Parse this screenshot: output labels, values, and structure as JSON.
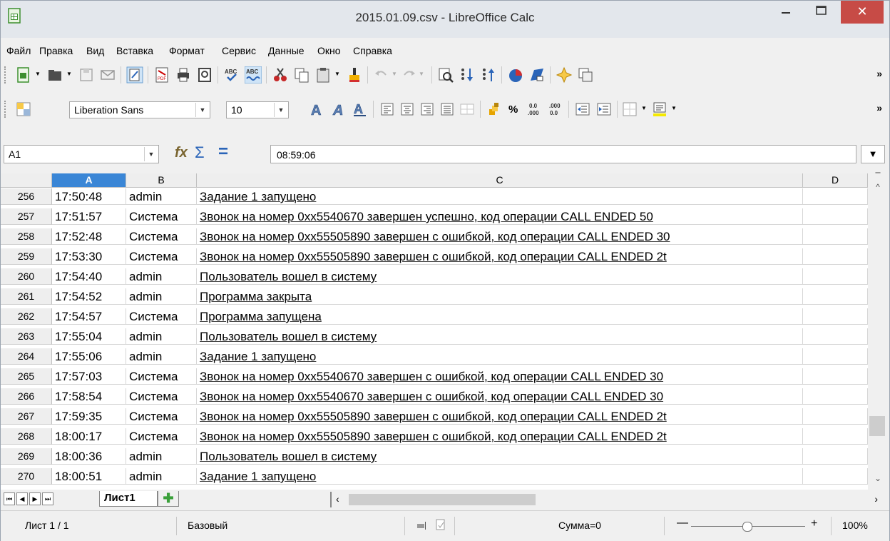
{
  "window": {
    "title": "2015.01.09.csv - LibreOffice Calc",
    "minimize": "–",
    "maximize": "☐",
    "close": "✕"
  },
  "menu": [
    {
      "label": "Файл"
    },
    {
      "label": "Правка"
    },
    {
      "label": "Вид"
    },
    {
      "label": "Вставка"
    },
    {
      "label": "Формат"
    },
    {
      "label": "Сервис"
    },
    {
      "label": "Данные"
    },
    {
      "label": "Окно"
    },
    {
      "label": "Справка"
    }
  ],
  "format_toolbar": {
    "font_name": "Liberation Sans",
    "font_size": "10",
    "percent": "%",
    "more": "»"
  },
  "standard_toolbar": {
    "more": "»"
  },
  "formula_bar": {
    "name_box": "A1",
    "content": "08:59:06"
  },
  "columns": [
    "A",
    "B",
    "C",
    "D"
  ],
  "selected_column": "A",
  "rows": [
    {
      "n": "256",
      "a": "17:50:48",
      "b": "admin",
      "c": "Задание 1 запущено"
    },
    {
      "n": "257",
      "a": "17:51:57",
      "b": "Система",
      "c": "Звонок на номер 0xx5540670 завершен успешно, код операции CALL ENDED 50"
    },
    {
      "n": "258",
      "a": "17:52:48",
      "b": "Система",
      "c": "Звонок на номер 0xx55505890 завершен с ошибкой, код операции CALL ENDED 30"
    },
    {
      "n": "259",
      "a": "17:53:30",
      "b": "Система",
      "c": "Звонок на номер 0xx55505890 завершен с ошибкой, код операции CALL ENDED 2t"
    },
    {
      "n": "260",
      "a": "17:54:40",
      "b": "admin",
      "c": "Пользователь вошел в систему"
    },
    {
      "n": "261",
      "a": "17:54:52",
      "b": "admin",
      "c": "Программа закрыта"
    },
    {
      "n": "262",
      "a": "17:54:57",
      "b": "Система",
      "c": "Программа запущена"
    },
    {
      "n": "263",
      "a": "17:55:04",
      "b": "admin",
      "c": "Пользователь вошел в систему"
    },
    {
      "n": "264",
      "a": "17:55:06",
      "b": "admin",
      "c": "Задание 1 запущено"
    },
    {
      "n": "265",
      "a": "17:57:03",
      "b": "Система",
      "c": "Звонок на номер 0xx5540670 завершен с ошибкой, код операции CALL ENDED 30"
    },
    {
      "n": "266",
      "a": "17:58:54",
      "b": "Система",
      "c": "Звонок на номер 0xx5540670 завершен с ошибкой, код операции CALL ENDED 30"
    },
    {
      "n": "267",
      "a": "17:59:35",
      "b": "Система",
      "c": "Звонок на номер 0xx55505890 завершен с ошибкой, код операции CALL ENDED 2t"
    },
    {
      "n": "268",
      "a": "18:00:17",
      "b": "Система",
      "c": "Звонок на номер 0xx55505890 завершен с ошибкой, код операции CALL ENDED 2t"
    },
    {
      "n": "269",
      "a": "18:00:36",
      "b": "admin",
      "c": "Пользователь вошел в систему"
    },
    {
      "n": "270",
      "a": "18:00:51",
      "b": "admin",
      "c": "Задание 1 запущено"
    }
  ],
  "sheet_tab": "Лист1",
  "status_bar": {
    "sheet": "Лист 1 / 1",
    "page_style": "Базовый",
    "sum": "Сумма=0",
    "zoom_minus": "—",
    "zoom_plus": "+",
    "zoom": "100%"
  },
  "colors": {
    "selected_header": "#3a86d6",
    "close_button": "#c74b46",
    "titlebar": "#e3e7ec"
  }
}
